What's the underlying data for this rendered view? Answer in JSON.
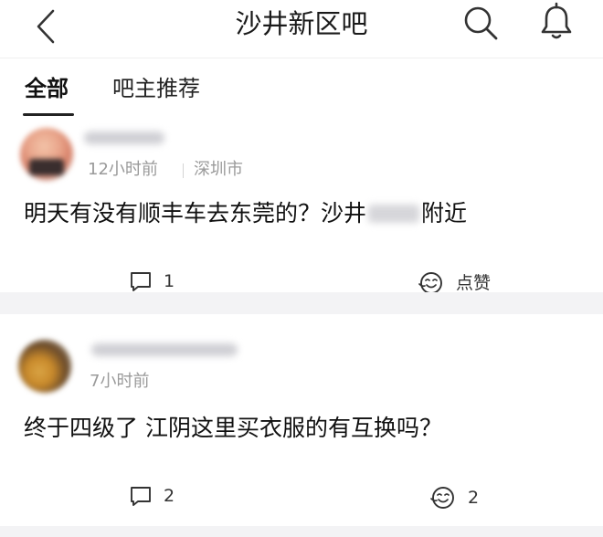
{
  "header": {
    "title": "沙井新区吧",
    "icons": {
      "back": "chevron-left-icon",
      "search": "search-icon",
      "notifications": "bell-icon"
    }
  },
  "tabs": [
    {
      "label": "全部",
      "active": true
    },
    {
      "label": "吧主推荐",
      "active": false
    }
  ],
  "posts": [
    {
      "time": "12小时前",
      "location": "深圳市",
      "content_before": "明天有没有顺丰车去东莞的？沙井",
      "content_after": "附近",
      "comments": "1",
      "like_label": "点赞"
    },
    {
      "time": "7小时前",
      "content": "终于四级了 江阴这里买衣服的有互换吗？",
      "comments": "2",
      "likes": "2"
    }
  ],
  "colors": {
    "accent": "#222222",
    "meta": "#9a9a9a",
    "separator": "#f3f3f5"
  }
}
